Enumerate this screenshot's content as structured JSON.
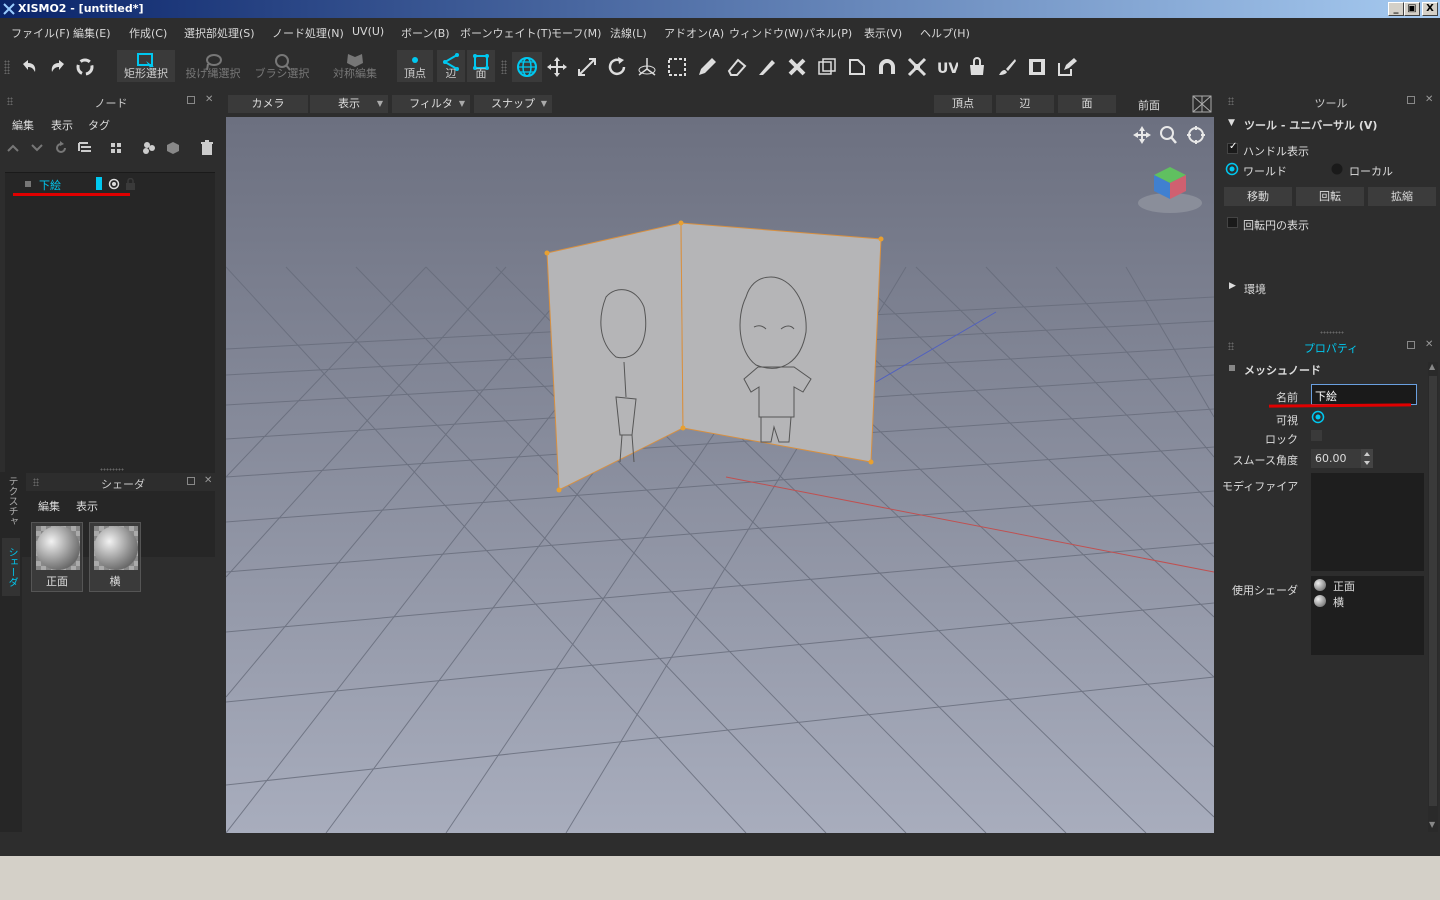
{
  "window": {
    "title": "XISMO2 - [untitled*]",
    "controls": [
      "_",
      "▣",
      "X"
    ]
  },
  "menu": [
    "ファイル(F)",
    "編集(E)",
    "作成(C)",
    "選択部処理(S)",
    "ノード処理(N)",
    "UV(U)",
    "ボーン(B)",
    "ボーンウェイト(T)",
    "モーフ(M)",
    "法線(L)",
    "アドオン(A)",
    "ウィンドウ(W)",
    "パネル(P)",
    "表示(V)",
    "ヘルプ(H)"
  ],
  "toolbar": {
    "rect_select": "矩形選択",
    "lasso_select": "投げ縄選択",
    "brush_select": "ブラシ選択",
    "symmetric_edit": "対称編集",
    "vertex": "頂点",
    "edge": "辺",
    "face": "面"
  },
  "node_panel": {
    "title": "ノード",
    "menu": [
      "編集",
      "表示",
      "タグ"
    ],
    "items": [
      {
        "name": "下絵"
      }
    ]
  },
  "shader_panel": {
    "title": "シェーダ",
    "menu": [
      "編集",
      "表示"
    ],
    "items": [
      {
        "name": "正面"
      },
      {
        "name": "横"
      }
    ]
  },
  "side_tabs": [
    "テクスチャ",
    "シェーダ"
  ],
  "viewport": {
    "buttons": {
      "camera": "カメラ",
      "display": "表示",
      "filter": "フィルタ",
      "snap": "スナップ"
    },
    "modes": [
      "頂点",
      "辺",
      "面"
    ],
    "view_name": "前面"
  },
  "tool_panel": {
    "title": "ツール",
    "section": "ツール - ユニバーサル (V)",
    "show_handle": "ハンドル表示",
    "world": "ワールド",
    "local": "ローカル",
    "buttons": [
      "移動",
      "回転",
      "拡縮"
    ],
    "show_rotation_circle": "回転円の表示",
    "environment": "環境"
  },
  "properties_panel": {
    "title": "プロパティ",
    "section": "メッシュノード",
    "name_label": "名前",
    "name_value": "下絵",
    "visible_label": "可視",
    "lock_label": "ロック",
    "smooth_label": "スムース角度",
    "smooth_value": "60.00",
    "modifier_label": "モディファイア",
    "shader_label": "使用シェーダ",
    "shaders": [
      "正面",
      "横"
    ]
  },
  "colors": {
    "accent": "#00c8f0",
    "annotation": "#e00000",
    "viewport_bg": "#9aa0b0",
    "panel_bg": "#2d2d2d"
  }
}
